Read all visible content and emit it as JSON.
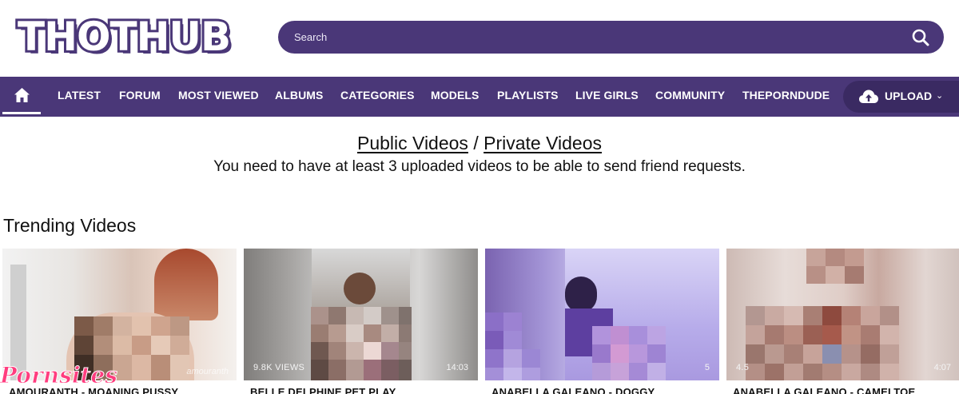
{
  "site": {
    "logo_text": "THOTHUB"
  },
  "search": {
    "placeholder": "Search"
  },
  "nav": {
    "items": [
      {
        "label": "LATEST"
      },
      {
        "label": "FORUM"
      },
      {
        "label": "MOST VIEWED"
      },
      {
        "label": "ALBUMS"
      },
      {
        "label": "CATEGORIES"
      },
      {
        "label": "MODELS"
      },
      {
        "label": "PLAYLISTS"
      },
      {
        "label": "LIVE GIRLS"
      },
      {
        "label": "COMMUNITY"
      },
      {
        "label": "THEPORNDUDE"
      }
    ],
    "upload_label": "UPLOAD"
  },
  "content": {
    "public_link": "Public Videos",
    "separator": "/",
    "private_link": "Private Videos",
    "notice": "You need to have at least 3 uploaded videos to be able to send friend requests.",
    "section_title": "Trending Videos"
  },
  "videos": [
    {
      "title": "AMOURANTH - MOANING PUSSY",
      "views": "",
      "duration": "",
      "watermark": "amouranth"
    },
    {
      "title": "BELLE DELPHINE PET PLAY",
      "views": "9.8K VIEWS",
      "duration": "14:03"
    },
    {
      "title": "ANABELLA GALEANO - DOGGY",
      "views": "",
      "duration": "5"
    },
    {
      "title": "ANABELLA GALEANO - CAMELTOE",
      "views": "4.5",
      "duration": "4:07"
    }
  ],
  "badge": {
    "text": "Pornsites"
  },
  "colors": {
    "brand_purple": "#4a3778",
    "upload_bg": "#3a2a62",
    "badge_pink": "#ff3d7f"
  }
}
